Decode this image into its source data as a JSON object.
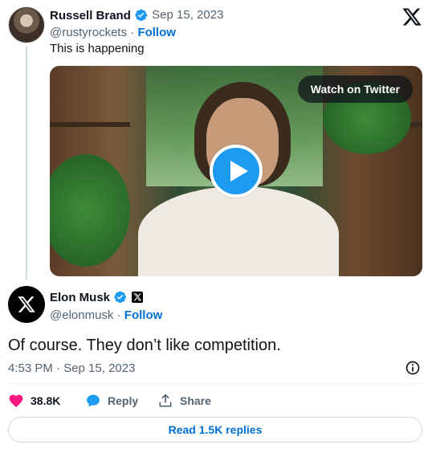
{
  "quoted_tweet": {
    "author_name": "Russell Brand",
    "date": "· Sep 15, 2023",
    "handle": "@rustyrockets",
    "handle_sep": " · ",
    "follow_label": "Follow",
    "text": "This is happening",
    "video": {
      "watch_label": "Watch on Twitter",
      "icon": "play-icon"
    }
  },
  "main_tweet": {
    "author_name": "Elon Musk",
    "handle": "@elonmusk",
    "handle_sep": " · ",
    "follow_label": "Follow",
    "text": "Of course. They don’t like competition.",
    "timestamp": "4:53 PM · Sep 15, 2023",
    "actions": {
      "like_count": "38.8K",
      "reply_label": "Reply",
      "share_label": "Share"
    },
    "read_replies_label": "Read 1.5K replies"
  },
  "colors": {
    "accent": "#1d9bf0",
    "link": "#006fd6",
    "like": "#f91880",
    "muted": "#536471"
  }
}
